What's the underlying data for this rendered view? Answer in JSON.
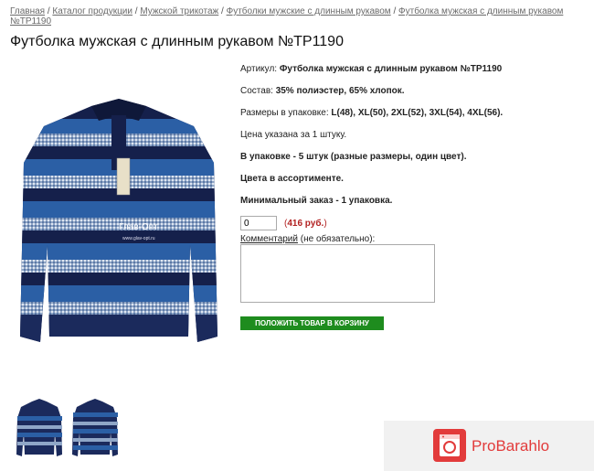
{
  "breadcrumbs": {
    "home": "Главная",
    "catalog": "Каталог продукции",
    "knitwear": "Мужской трикотаж",
    "longsleeve": "Футболки мужские с длинным рукавом",
    "current": "Футболка мужская с длинным рукавом №TP1190",
    "separator": "/"
  },
  "product": {
    "title": "Футболка мужская с длинным рукавом №TP1190",
    "article_label": "Артикул:",
    "article_value": "Футболка мужская с длинным рукавом №TP1190",
    "composition_label": "Состав:",
    "composition_value": "35% полиэстер, 65% хлопок.",
    "sizes_label": "Размеры в упаковке:",
    "sizes_value": "L(48), XL(50), 2XL(52), 3XL(54), 4XL(56).",
    "price_note": "Цена указана за 1 штуку.",
    "pack_info": "В упаковке - 5 штук (разные размеры, один цвет).",
    "colors_note": "Цвета в ассортименте.",
    "min_order": "Минимальный заказ - 1 упаковка.",
    "quantity": "0",
    "price_open": "(",
    "price_value": "416 руб.",
    "price_close": ")",
    "comment_link": "Комментарий",
    "comment_optional": " (не обязательно):",
    "add_to_cart": "ПОЛОЖИТЬ ТОВАР В КОРЗИНУ"
  },
  "image_watermark": {
    "brand": "Глав-Опт",
    "site": "www.glav-opt.ru"
  },
  "badge": {
    "text": "ProBarahlo"
  }
}
